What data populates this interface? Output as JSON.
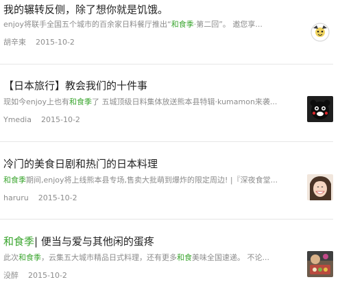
{
  "articles": [
    {
      "title": "我的辗转反侧，除了想你就是饥饿。",
      "snippet_before": "enjoy将联手全国五个城市的百余家日料餐厅推出“",
      "snippet_highlight": "和食季",
      "snippet_after": "·第二回”。 邀您享...",
      "author": "胡辛束",
      "date": "2015-10-2",
      "thumb_icon": "logo-thumbnail-icon"
    },
    {
      "title": "【日本旅行】教会我们的十件事",
      "snippet_before": "现如今enjoy上也有",
      "snippet_highlight": "和食季",
      "snippet_after": "了 五城顶级日料集体放送熊本县特辑·kumamon来袭...",
      "author": "Ymedia",
      "date": "2015-10-2",
      "thumb_icon": "kumamon-thumbnail-icon"
    },
    {
      "title": "冷门的美食日剧和热门的日本料理",
      "snippet_before": "",
      "snippet_highlight": "和食季",
      "snippet_after": "期间,enjoy将上线熊本县专场,售卖大批萌到爆炸的限定周边! |『深夜食堂...",
      "author": "haruru",
      "date": "2015-10-2",
      "thumb_icon": "smiling-girl-thumbnail-icon"
    },
    {
      "title_highlight": "和食季",
      "title_after": "| 便当与爱与其他闲的蛋疼",
      "snippet_before": "此次",
      "snippet_highlight": "和食季",
      "snippet_mid": "，云集五大城市精品日式料理，还有更多",
      "snippet_highlight2": "和食",
      "snippet_after": "美味全国速递。 不论...",
      "author": "没醉",
      "date": "2015-10-2",
      "thumb_icon": "food-photo-thumbnail-icon"
    }
  ],
  "colors": {
    "highlight": "#3aa52e",
    "title": "#222222",
    "muted": "#8c8c8c",
    "divider": "#e6e6e6"
  }
}
